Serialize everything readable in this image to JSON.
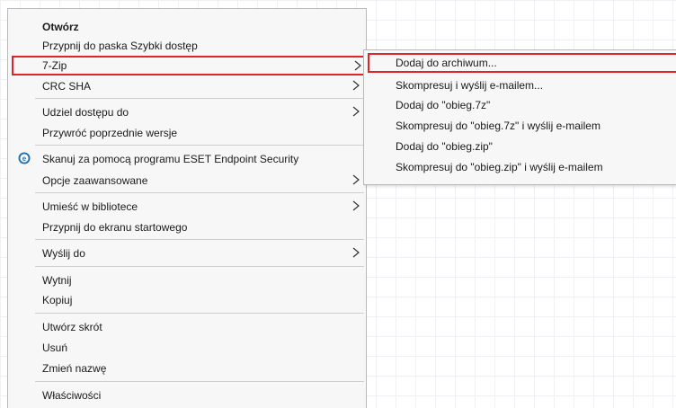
{
  "context_menu": {
    "items": [
      {
        "label": "Otwórz"
      },
      {
        "label": "Przypnij do paska Szybki dostęp"
      },
      {
        "label": "7-Zip"
      },
      {
        "label": "CRC SHA"
      },
      {
        "label": "Udziel dostępu do"
      },
      {
        "label": "Przywróć poprzednie wersje"
      },
      {
        "label": "Skanuj za pomocą programu ESET Endpoint Security",
        "icon": "eset-icon"
      },
      {
        "label": "Opcje zaawansowane"
      },
      {
        "label": "Umieść w bibliotece"
      },
      {
        "label": "Przypnij do ekranu startowego"
      },
      {
        "label": "Wyślij do"
      },
      {
        "label": "Wytnij"
      },
      {
        "label": "Kopiuj"
      },
      {
        "label": "Utwórz skrót"
      },
      {
        "label": "Usuń"
      },
      {
        "label": "Zmień nazwę"
      },
      {
        "label": "Właściwości"
      }
    ]
  },
  "submenu_7zip": {
    "items": [
      {
        "label": "Dodaj do archiwum..."
      },
      {
        "label": "Skompresuj i wyślij e-mailem..."
      },
      {
        "label": "Dodaj do \"obieg.7z\""
      },
      {
        "label": "Skompresuj do \"obieg.7z\" i wyślij e-mailem"
      },
      {
        "label": "Dodaj do \"obieg.zip\""
      },
      {
        "label": "Skompresuj do \"obieg.zip\" i wyślij e-mailem"
      }
    ]
  },
  "colors": {
    "highlight_border": "#e1242c",
    "menu_background": "#f7f7f7",
    "eset_icon": "#1f6fb5"
  }
}
